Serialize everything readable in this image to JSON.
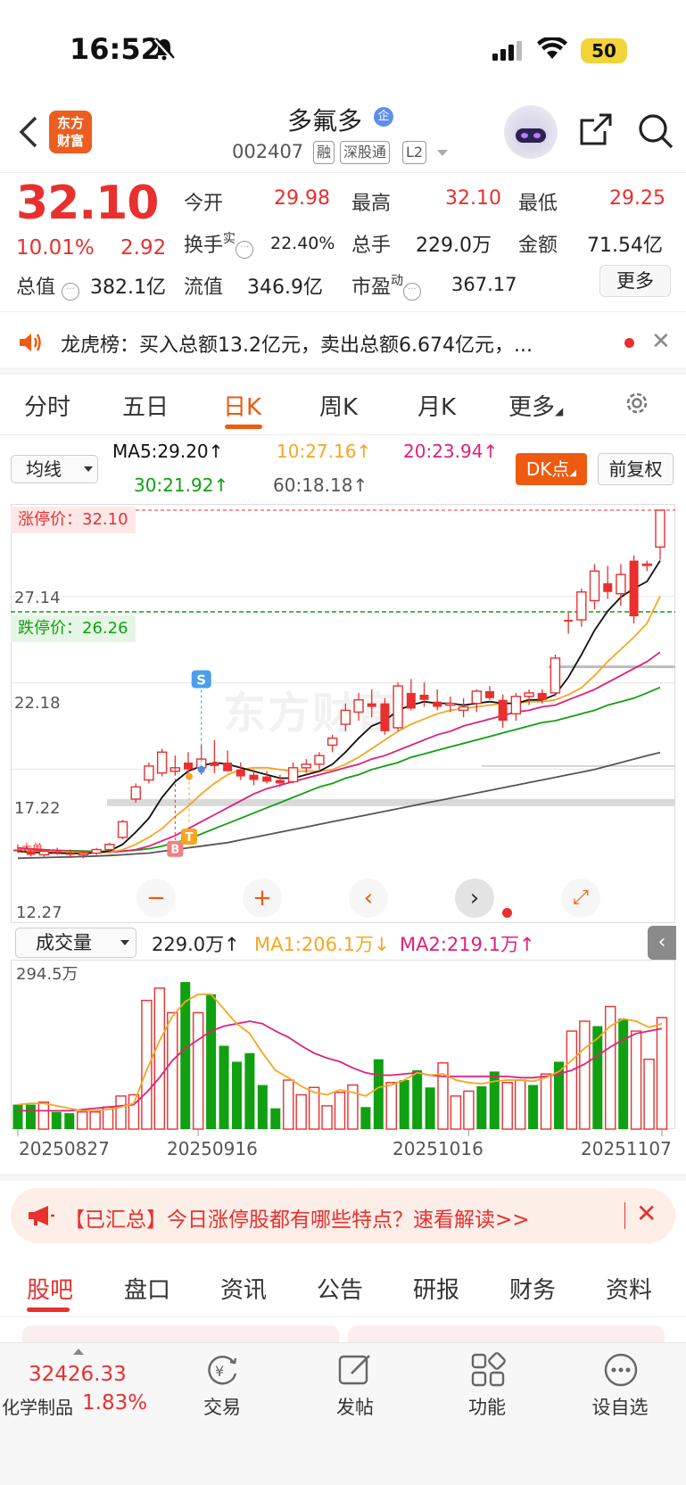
{
  "status_bar": {
    "time": "16:52",
    "battery": "50"
  },
  "header": {
    "brand_line1": "东方",
    "brand_line2": "财富",
    "stock_name": "多氟多",
    "enterprise_badge": "企",
    "stock_code": "002407",
    "tags": [
      "融",
      "深股通",
      "L2"
    ]
  },
  "quote": {
    "last_price": "32.10",
    "pct_change": "10.01%",
    "abs_change": "2.92",
    "open_label": "今开",
    "open": "29.98",
    "high_label": "最高",
    "high": "32.10",
    "low_label": "最低",
    "low": "29.25",
    "turnover_label": "换手",
    "turnover_sup": "实",
    "turnover": "22.40%",
    "volume_label": "总手",
    "volume": "229.0万",
    "amount_label": "金额",
    "amount": "71.54亿",
    "mktcap_label": "总值",
    "mktcap": "382.1亿",
    "float_label": "流值",
    "float_cap": "346.9亿",
    "pe_label": "市盈",
    "pe_sup": "动",
    "pe": "367.17",
    "more_label": "更多"
  },
  "dragon_tiger": {
    "text": "龙虎榜：买入总额13.2亿元，卖出总额6.674亿元，..."
  },
  "period_tabs": [
    "分时",
    "五日",
    "日K",
    "周K",
    "月K",
    "更多"
  ],
  "active_period": "日K",
  "ma_bar": {
    "select_label": "均线",
    "ma5": "MA5:29.20↑",
    "ma10": "10:27.16↑",
    "ma20": "20:23.94↑",
    "ma30": "30:21.92↑",
    "ma60": "60:18.18↑",
    "dk_label": "DK点",
    "fuquan_label": "前复权"
  },
  "kline": {
    "limit_up_label": "涨停价：32.10",
    "limit_down_label": "跌停价：26.26",
    "y_ticks": [
      "32.10",
      "27.14",
      "22.18",
      "17.22",
      "12.27"
    ],
    "watermark": "东方财富",
    "markers": {
      "sell": "S",
      "buy": "B",
      "t": "T"
    },
    "candle_marker_label": "大单"
  },
  "volume_bar": {
    "select_label": "成交量",
    "vol": "229.0万↑",
    "ma1": "MA1:206.1万↓",
    "ma2": "MA2:219.1万↑",
    "max_label": "294.5万"
  },
  "x_dates": [
    "20250827",
    "20250916",
    "20251016",
    "20251107"
  ],
  "chart_data": {
    "type": "candlestick",
    "ylim": [
      12.27,
      32.1
    ],
    "colors": {
      "up": "#e8302f",
      "down": "#e8302f",
      "ma5": "#111111",
      "ma10": "#f5a623",
      "ma20": "#e0207a",
      "ma30": "#11a011",
      "ma60": "#555555",
      "vol_up": "#e8302f",
      "vol_down": "#11a011"
    },
    "ohlc": [
      [
        12.6,
        12.9,
        12.4,
        12.5
      ],
      [
        12.5,
        12.6,
        12.2,
        12.3
      ],
      [
        12.3,
        12.6,
        12.2,
        12.5
      ],
      [
        12.5,
        12.7,
        12.3,
        12.4
      ],
      [
        12.4,
        12.6,
        12.2,
        12.3
      ],
      [
        12.3,
        12.5,
        12.1,
        12.4
      ],
      [
        12.4,
        12.7,
        12.3,
        12.6
      ],
      [
        12.6,
        13.0,
        12.4,
        12.9
      ],
      [
        13.3,
        14.3,
        13.2,
        14.2
      ],
      [
        15.5,
        16.4,
        15.3,
        16.2
      ],
      [
        16.6,
        17.6,
        16.4,
        17.4
      ],
      [
        17.0,
        18.4,
        16.8,
        18.2
      ],
      [
        17.1,
        18.0,
        16.9,
        17.3
      ],
      [
        17.6,
        18.2,
        16.7,
        17.2
      ],
      [
        17.3,
        18.6,
        16.9,
        17.8
      ],
      [
        17.6,
        18.9,
        17.0,
        17.4
      ],
      [
        17.6,
        18.3,
        17.2,
        17.1
      ],
      [
        17.2,
        17.6,
        16.6,
        16.8
      ],
      [
        16.9,
        17.2,
        16.3,
        16.6
      ],
      [
        16.8,
        17.1,
        16.4,
        16.5
      ],
      [
        16.6,
        16.9,
        16.2,
        16.4
      ],
      [
        16.5,
        17.6,
        16.4,
        17.3
      ],
      [
        17.3,
        17.8,
        17.0,
        17.5
      ],
      [
        17.5,
        18.2,
        17.2,
        18.0
      ],
      [
        18.6,
        19.2,
        18.2,
        19.0
      ],
      [
        19.8,
        21.0,
        19.4,
        20.6
      ],
      [
        20.5,
        21.6,
        20.0,
        21.2
      ],
      [
        21.0,
        21.8,
        20.2,
        20.8
      ],
      [
        21.0,
        21.3,
        19.2,
        19.4
      ],
      [
        19.6,
        22.2,
        19.4,
        22.0
      ],
      [
        21.6,
        22.4,
        20.6,
        20.7
      ],
      [
        21.5,
        22.2,
        20.8,
        21.2
      ],
      [
        21.1,
        21.8,
        20.6,
        20.8
      ],
      [
        20.9,
        21.4,
        20.5,
        21.0
      ],
      [
        20.6,
        21.3,
        20.2,
        20.8
      ],
      [
        21.0,
        21.8,
        20.5,
        21.7
      ],
      [
        21.7,
        22.0,
        21.2,
        21.3
      ],
      [
        21.2,
        21.5,
        19.6,
        20.0
      ],
      [
        20.4,
        21.6,
        20.0,
        21.4
      ],
      [
        21.4,
        21.8,
        20.9,
        21.6
      ],
      [
        21.6,
        21.8,
        21.0,
        21.2
      ],
      [
        21.6,
        23.8,
        21.4,
        23.6
      ],
      [
        25.8,
        26.2,
        25.0,
        25.7
      ],
      [
        25.8,
        27.6,
        25.4,
        27.4
      ],
      [
        26.9,
        29.0,
        26.4,
        28.6
      ],
      [
        27.9,
        28.9,
        27.0,
        27.4
      ],
      [
        27.3,
        29.0,
        26.6,
        28.4
      ],
      [
        29.2,
        29.5,
        25.6,
        26.0
      ],
      [
        29.0,
        29.2,
        28.6,
        29.0
      ],
      [
        29.98,
        32.1,
        29.25,
        32.1
      ]
    ],
    "ma5": [
      12.5,
      12.45,
      12.42,
      12.4,
      12.38,
      12.38,
      12.42,
      12.52,
      12.9,
      13.6,
      14.4,
      15.6,
      16.5,
      17.1,
      17.4,
      17.6,
      17.5,
      17.3,
      17.1,
      16.9,
      16.7,
      16.7,
      16.9,
      17.1,
      17.5,
      18.2,
      19.0,
      19.7,
      20.0,
      20.6,
      20.9,
      21.1,
      21.0,
      21.0,
      20.9,
      21.0,
      21.1,
      21.0,
      21.0,
      21.2,
      21.2,
      21.5,
      22.5,
      23.8,
      25.2,
      26.3,
      27.1,
      27.6,
      28.0,
      29.2
    ],
    "ma10": [
      12.6,
      12.55,
      12.5,
      12.48,
      12.45,
      12.42,
      12.42,
      12.45,
      12.6,
      12.9,
      13.3,
      13.8,
      14.5,
      15.1,
      15.8,
      16.4,
      16.9,
      17.2,
      17.3,
      17.3,
      17.2,
      17.1,
      17.1,
      17.1,
      17.2,
      17.5,
      17.9,
      18.4,
      18.9,
      19.4,
      19.8,
      20.1,
      20.4,
      20.6,
      20.7,
      20.8,
      20.9,
      21.0,
      21.0,
      21.1,
      21.1,
      21.2,
      21.5,
      21.9,
      22.6,
      23.4,
      24.1,
      24.8,
      25.6,
      27.16
    ],
    "ma20": [
      12.7,
      12.65,
      12.6,
      12.55,
      12.5,
      12.48,
      12.46,
      12.45,
      12.5,
      12.6,
      12.8,
      13.1,
      13.4,
      13.8,
      14.2,
      14.6,
      15.0,
      15.4,
      15.8,
      16.1,
      16.3,
      16.5,
      16.7,
      16.9,
      17.1,
      17.3,
      17.5,
      17.8,
      18.0,
      18.3,
      18.6,
      18.9,
      19.2,
      19.4,
      19.7,
      19.9,
      20.1,
      20.3,
      20.5,
      20.6,
      20.8,
      20.9,
      21.2,
      21.5,
      21.8,
      22.2,
      22.6,
      23.0,
      23.4,
      23.94
    ],
    "ma30": [
      12.6,
      12.58,
      12.56,
      12.55,
      12.53,
      12.52,
      12.5,
      12.5,
      12.52,
      12.56,
      12.65,
      12.8,
      13.0,
      13.2,
      13.5,
      13.8,
      14.1,
      14.4,
      14.7,
      15.0,
      15.3,
      15.6,
      15.9,
      16.2,
      16.4,
      16.7,
      16.9,
      17.2,
      17.4,
      17.6,
      17.9,
      18.1,
      18.3,
      18.5,
      18.7,
      18.9,
      19.1,
      19.3,
      19.5,
      19.7,
      19.9,
      20.0,
      20.2,
      20.4,
      20.6,
      20.9,
      21.1,
      21.3,
      21.6,
      21.92
    ],
    "ma60": [
      12.1,
      12.12,
      12.14,
      12.16,
      12.18,
      12.2,
      12.23,
      12.26,
      12.3,
      12.35,
      12.4,
      12.5,
      12.6,
      12.7,
      12.8,
      12.9,
      13.0,
      13.15,
      13.3,
      13.45,
      13.6,
      13.75,
      13.9,
      14.05,
      14.2,
      14.35,
      14.5,
      14.65,
      14.8,
      14.95,
      15.1,
      15.25,
      15.4,
      15.55,
      15.7,
      15.85,
      16.0,
      16.15,
      16.3,
      16.45,
      16.6,
      16.75,
      16.9,
      17.05,
      17.2,
      17.4,
      17.6,
      17.8,
      18.0,
      18.18
    ],
    "volume": [
      20,
      20,
      22,
      14,
      13,
      14,
      14,
      18,
      27,
      28,
      105,
      115,
      95,
      120,
      95,
      110,
      68,
      55,
      62,
      36,
      17,
      40,
      28,
      34,
      19,
      30,
      36,
      18,
      57,
      38,
      40,
      48,
      34,
      54,
      27,
      31,
      35,
      47,
      38,
      40,
      36,
      45,
      55,
      80,
      88,
      84,
      100,
      90,
      80,
      57,
      91
    ],
    "vol_ma1": [
      20,
      21,
      21,
      19,
      17,
      15,
      15,
      16,
      18,
      21,
      48,
      72,
      92,
      104,
      110,
      110,
      98,
      86,
      78,
      62,
      48,
      42,
      35,
      30,
      28,
      32,
      30,
      27,
      34,
      36,
      40,
      46,
      44,
      45,
      40,
      38,
      37,
      39,
      40,
      40,
      39,
      42,
      47,
      56,
      66,
      74,
      84,
      90,
      88,
      83,
      86
    ],
    "vol_ma2": [
      15,
      15,
      15,
      15,
      15,
      16,
      17,
      18,
      19,
      20,
      30,
      42,
      56,
      66,
      73,
      80,
      84,
      86,
      88,
      86,
      80,
      75,
      68,
      62,
      58,
      55,
      50,
      46,
      44,
      44,
      45,
      46,
      44,
      43,
      43,
      43,
      43,
      43,
      43,
      42,
      42,
      43,
      45,
      48,
      53,
      60,
      67,
      73,
      78,
      80,
      82
    ],
    "vol_max": 294.5
  },
  "promo": {
    "text": "【已汇总】今日涨停股都有哪些特点？速看解读>>"
  },
  "content_tabs": [
    "股吧",
    "盘口",
    "资讯",
    "公告",
    "研报",
    "财务",
    "资料"
  ],
  "bottom_nav": {
    "index_value": "32426.33",
    "index_name": "化学制品",
    "index_pct": "1.83%",
    "items": [
      "交易",
      "发帖",
      "功能",
      "设自选"
    ]
  }
}
